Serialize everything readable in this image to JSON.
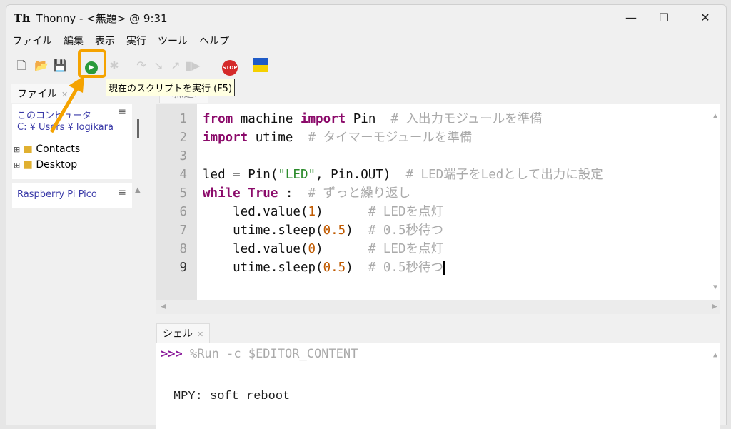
{
  "window": {
    "title": "Thonny - <無題> @ 9:31",
    "logo": "Th",
    "minimize": "—",
    "maximize": "☐",
    "close": "✕"
  },
  "menu": [
    "ファイル",
    "編集",
    "表示",
    "実行",
    "ツール",
    "ヘルプ"
  ],
  "toolbar": {
    "tooltip": "現在のスクリプトを実行 (F5)",
    "stop_label": "STOP",
    "accent": "#f5a300"
  },
  "files": {
    "tab": "ファイル",
    "computer_title": "このコンピュータ",
    "path": "C: ¥ Users ¥ logikara",
    "items": [
      "Contacts",
      "Desktop"
    ],
    "device_title": "Raspberry Pi Pico"
  },
  "editor": {
    "tab": "<無題>",
    "lines": [
      [
        [
          "kw",
          "from"
        ],
        [
          "",
          "machine "
        ],
        [
          "kw",
          "import"
        ],
        [
          "",
          "Pin  "
        ],
        [
          "cm",
          "# 入出力モジュールを準備"
        ]
      ],
      [
        [
          "kw",
          "import"
        ],
        [
          "",
          "utime  "
        ],
        [
          "cm",
          "# タイマーモジュールを準備"
        ]
      ],
      [],
      [
        [
          "",
          "led = Pin("
        ],
        [
          "str",
          "\"LED\""
        ],
        [
          "",
          ", Pin.OUT)  "
        ],
        [
          "cm",
          "# LED端子をLedとして出力に設定"
        ]
      ],
      [
        [
          "kw",
          "while"
        ],
        [
          "",
          "",
          "x"
        ],
        [
          "kw",
          "True"
        ],
        [
          "",
          ":  "
        ],
        [
          "cm",
          "# ずっと繰り返し"
        ]
      ],
      [
        [
          "",
          "    led.value("
        ],
        [
          "num",
          "1"
        ],
        [
          "",
          ")      "
        ],
        [
          "cm",
          "# LEDを点灯"
        ]
      ],
      [
        [
          "",
          "    utime.sleep("
        ],
        [
          "num",
          "0.5"
        ],
        [
          "",
          ")  "
        ],
        [
          "cm",
          "# 0.5秒待つ"
        ]
      ],
      [
        [
          "",
          "    led.value("
        ],
        [
          "num",
          "0"
        ],
        [
          "",
          ")      "
        ],
        [
          "cm",
          "# LEDを点灯"
        ]
      ],
      [
        [
          "",
          "    utime.sleep("
        ],
        [
          "num",
          "0.5"
        ],
        [
          "",
          ")  "
        ],
        [
          "cm",
          "# 0.5秒待つ"
        ]
      ]
    ]
  },
  "shell": {
    "tab": "シェル",
    "prompt": ">>>",
    "command": " %Run -c $EDITOR_CONTENT",
    "output": "MPY: soft reboot"
  }
}
